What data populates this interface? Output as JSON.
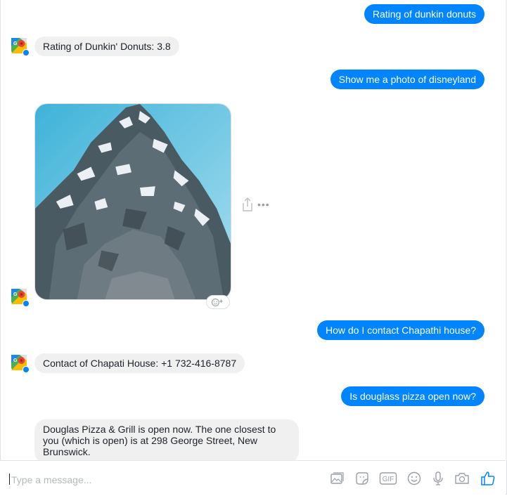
{
  "messages": [
    {
      "from": "user",
      "text": "Rating of dunkin donuts"
    },
    {
      "from": "bot",
      "text": "Rating of Dunkin' Donuts: 3.8"
    },
    {
      "from": "user",
      "text": "Show me a photo of disneyland"
    },
    {
      "from": "user",
      "text": "How do I contact Chapathi house?"
    },
    {
      "from": "bot",
      "text": "Contact of Chapati House: +1 732-416-8787"
    },
    {
      "from": "user",
      "text": "Is douglass pizza open now?"
    },
    {
      "from": "bot",
      "text": "Douglas Pizza & Grill is open now. The one closest to you (which is open) is at 298 George Street, New Brunswick."
    }
  ],
  "composer": {
    "placeholder": "Type a message...",
    "tools": [
      "image-icon",
      "sticker-icon",
      "gif-icon",
      "emoji-icon",
      "microphone-icon",
      "camera-icon",
      "thumbs-up-icon"
    ],
    "gif_label": "GIF"
  },
  "colors": {
    "accent": "#0084ff",
    "incoming_bubble": "#f1f0f0",
    "icon_gray": "#9a9fa6"
  }
}
